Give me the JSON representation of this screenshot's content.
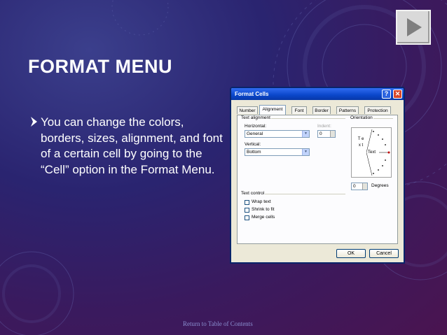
{
  "slide": {
    "title": "FORMAT MENU",
    "bullet": "You can change the colors, borders, sizes, alignment, and font of a certain cell by going to the “Cell” option in the Format Menu.",
    "footer_link": "Return to Table of Contents",
    "next_button_icon": "play-triangle-icon"
  },
  "dialog": {
    "title": "Format Cells",
    "help_label": "?",
    "close_label": "✕",
    "tabs": [
      "Number",
      "Alignment",
      "Font",
      "Border",
      "Patterns",
      "Protection"
    ],
    "active_tab": "Alignment",
    "text_alignment": {
      "group_label": "Text alignment",
      "horizontal_label": "Horizontal:",
      "horizontal_value": "General",
      "indent_label": "Indent:",
      "indent_value": "0",
      "vertical_label": "Vertical:",
      "vertical_value": "Bottom"
    },
    "orientation": {
      "group_label": "Orientation",
      "vertical_text": "T e x t",
      "dial_label": "Text",
      "degrees_value": "0",
      "degrees_label": "Degrees"
    },
    "text_control": {
      "group_label": "Text control",
      "wrap_text": "Wrap text",
      "shrink_to_fit": "Shrink to fit",
      "merge_cells": "Merge cells"
    },
    "ok_label": "OK",
    "cancel_label": "Cancel"
  },
  "colors": {
    "background": "#2a2470",
    "title_text": "#ffffff",
    "xp_titlebar": "#0a46c9",
    "close_red": "#d8482a"
  }
}
